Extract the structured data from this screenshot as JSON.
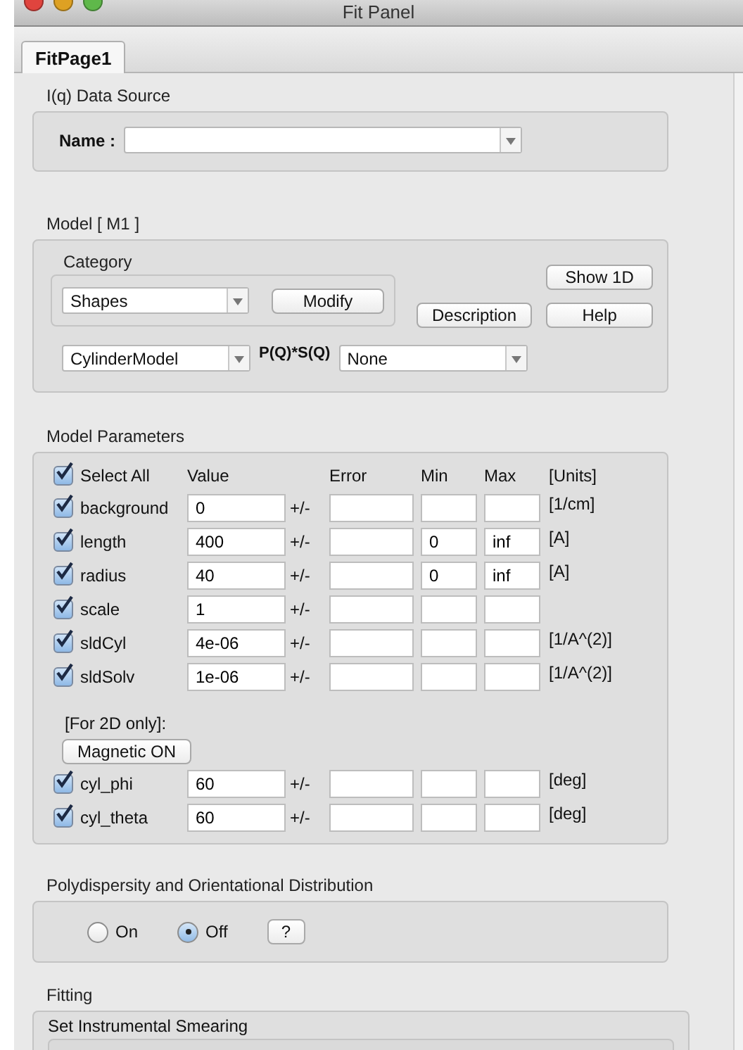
{
  "window": {
    "title": "Fit Panel"
  },
  "tabs": [
    {
      "label": "FitPage1",
      "selected": true
    }
  ],
  "data_source": {
    "title": "I(q) Data Source",
    "name_label": "Name :"
  },
  "model": {
    "title": "Model [ M1 ]",
    "category_label": "Category",
    "category": "Shapes",
    "modify_button": "Modify",
    "description_button": "Description",
    "show_button": "Show 1D",
    "help_button": "Help",
    "model": "CylinderModel",
    "structure_label": "P(Q)*S(Q)",
    "structure": "None"
  },
  "parameters": {
    "title": "Model Parameters",
    "select_all": {
      "label": "Select All",
      "checked": true
    },
    "columns": [
      "Value",
      "Error",
      "Min",
      "Max",
      "[Units]"
    ],
    "rows": [
      {
        "name": "background",
        "checked": true,
        "value": "0",
        "pm": "+/-",
        "units": "[1/cm]"
      },
      {
        "name": "length",
        "checked": true,
        "value": "400",
        "pm": "+/-",
        "min": "0",
        "max": "inf",
        "units": "[A]"
      },
      {
        "name": "radius",
        "checked": true,
        "value": "40",
        "pm": "+/-",
        "min": "0",
        "max": "inf",
        "units": "[A]"
      },
      {
        "name": "scale",
        "checked": true,
        "value": "1",
        "pm": "+/-"
      },
      {
        "name": "sldCyl",
        "checked": true,
        "value": "4e-06",
        "pm": "+/-",
        "units": "[1/A^(2)]"
      },
      {
        "name": "sldSolv",
        "checked": true,
        "value": "1e-06",
        "pm": "+/-",
        "units": "[1/A^(2)]"
      }
    ],
    "note": "[For 2D only]:",
    "magnetic_button": "Magnetic ON",
    "rows_2d": [
      {
        "name": "cyl_phi",
        "checked": true,
        "value": "60",
        "pm": "+/-",
        "units": "[deg]"
      },
      {
        "name": "cyl_theta",
        "checked": true,
        "value": "60",
        "pm": "+/-",
        "units": "[deg]"
      }
    ]
  },
  "polydispersity": {
    "title": "Polydispersity and Orientational Distribution",
    "options": [
      {
        "label": "On",
        "selected": false
      },
      {
        "label": "Off",
        "selected": true
      }
    ],
    "help_button": "?"
  },
  "fitting": {
    "title": "Fitting",
    "smearing_title": "Set Instrumental Smearing"
  }
}
